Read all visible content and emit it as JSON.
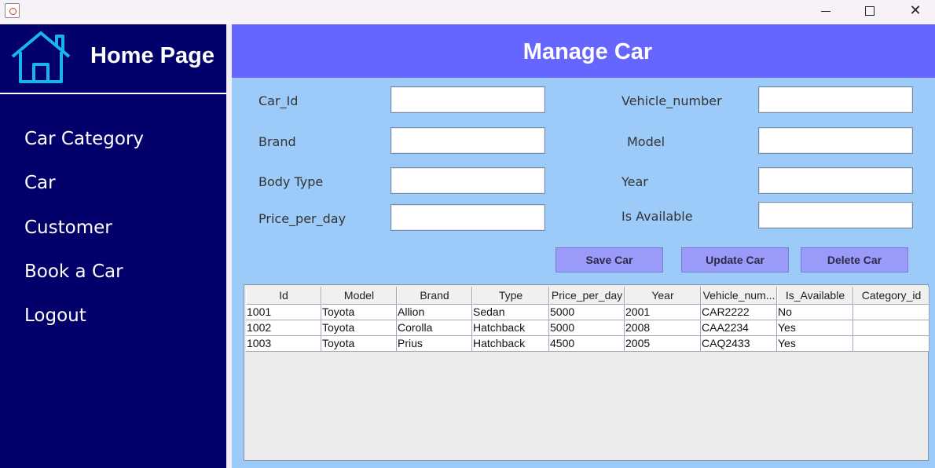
{
  "window": {
    "minimize_icon": "minimize-icon",
    "maximize_icon": "maximize-icon",
    "close_glyph": "✕"
  },
  "sidebar": {
    "title": "Home Page",
    "icon": "home-icon",
    "items": [
      {
        "label": "Car Category"
      },
      {
        "label": "Car"
      },
      {
        "label": "Customer"
      },
      {
        "label": "Book a Car"
      },
      {
        "label": "Logout"
      }
    ]
  },
  "header": {
    "title": "Manage Car"
  },
  "form": {
    "car_id": {
      "label": "Car_Id",
      "value": ""
    },
    "vehicle_number": {
      "label": "Vehicle_number",
      "value": ""
    },
    "brand": {
      "label": "Brand",
      "value": ""
    },
    "model": {
      "label": "Model",
      "value": ""
    },
    "body_type": {
      "label": "Body Type",
      "value": ""
    },
    "year": {
      "label": "Year",
      "value": ""
    },
    "price_per_day": {
      "label": "Price_per_day",
      "value": ""
    },
    "is_available": {
      "label": "Is Available",
      "value": ""
    }
  },
  "actions": {
    "save": "Save Car",
    "update": "Update Car",
    "delete": "Delete Car"
  },
  "table": {
    "columns": [
      "Id",
      "Model",
      "Brand",
      "Type",
      "Price_per_day",
      "Year",
      "Vehicle_num...",
      "Is_Available",
      "Category_id"
    ],
    "rows": [
      [
        "1001",
        "Toyota",
        "Allion",
        "Sedan",
        "5000",
        "2001",
        "CAR2222",
        "No",
        ""
      ],
      [
        "1002",
        "Toyota",
        "Corolla",
        "Hatchback",
        "5000",
        "2008",
        "CAA2234",
        "Yes",
        ""
      ],
      [
        "1003",
        "Toyota",
        "Prius",
        "Hatchback",
        "4500",
        "2005",
        "CAQ2433",
        "Yes",
        ""
      ]
    ]
  },
  "colors": {
    "sidebar_bg": "#02006b",
    "header_bg": "#6666ff",
    "panel_bg": "#9ccbfa",
    "button_bg": "#9a9af8",
    "home_icon": "#19b4f0"
  }
}
